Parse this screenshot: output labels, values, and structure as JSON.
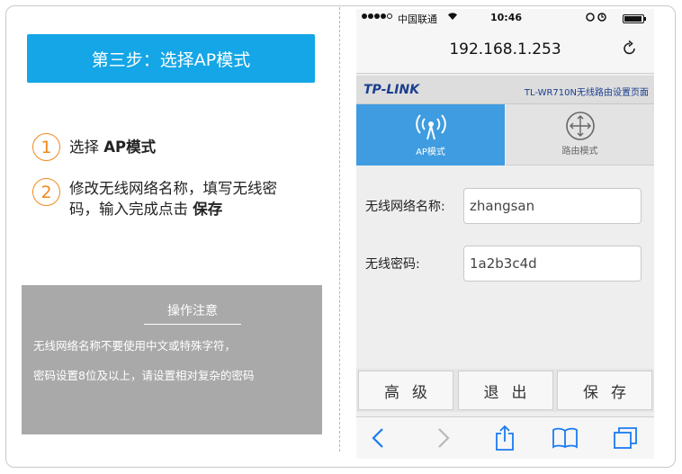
{
  "left": {
    "step_title": "第三步：选择AP模式",
    "steps": [
      {
        "num": "1",
        "text": "选择 ",
        "bold": "AP模式"
      },
      {
        "num": "2",
        "text_line1": "修改无线网络名称，填写无线密",
        "text_line2": "码，输入完成点击 ",
        "bold": "保存"
      }
    ],
    "notice": {
      "title": "操作注意",
      "lines": [
        "无线网络名称不要使用中文或特殊字符，",
        "密码设置8位及以上，请设置相对复杂的密码"
      ]
    }
  },
  "phone": {
    "status": {
      "carrier": "中国联通",
      "time": "10:46"
    },
    "url": "192.168.1.253",
    "brand": {
      "logo": "TP-LINK",
      "title": "TL-WR710N无线路由设置页面"
    },
    "modes": [
      {
        "label": "AP模式",
        "icon": "antenna-icon",
        "selected": true
      },
      {
        "label": "路由模式",
        "icon": "router-icon",
        "selected": false
      }
    ],
    "fields": {
      "ssid": {
        "label": "无线网络名称:",
        "value": "zhangsan"
      },
      "password": {
        "label": "无线密码:",
        "value": "1a2b3c4d"
      }
    },
    "actions": [
      "高级",
      "退出",
      "保存"
    ],
    "colors": {
      "accent": "#14a6e6",
      "selected_tab": "#3f9ce0",
      "step_number": "#f08a1c",
      "safari_blue": "#1a7bf2"
    }
  }
}
